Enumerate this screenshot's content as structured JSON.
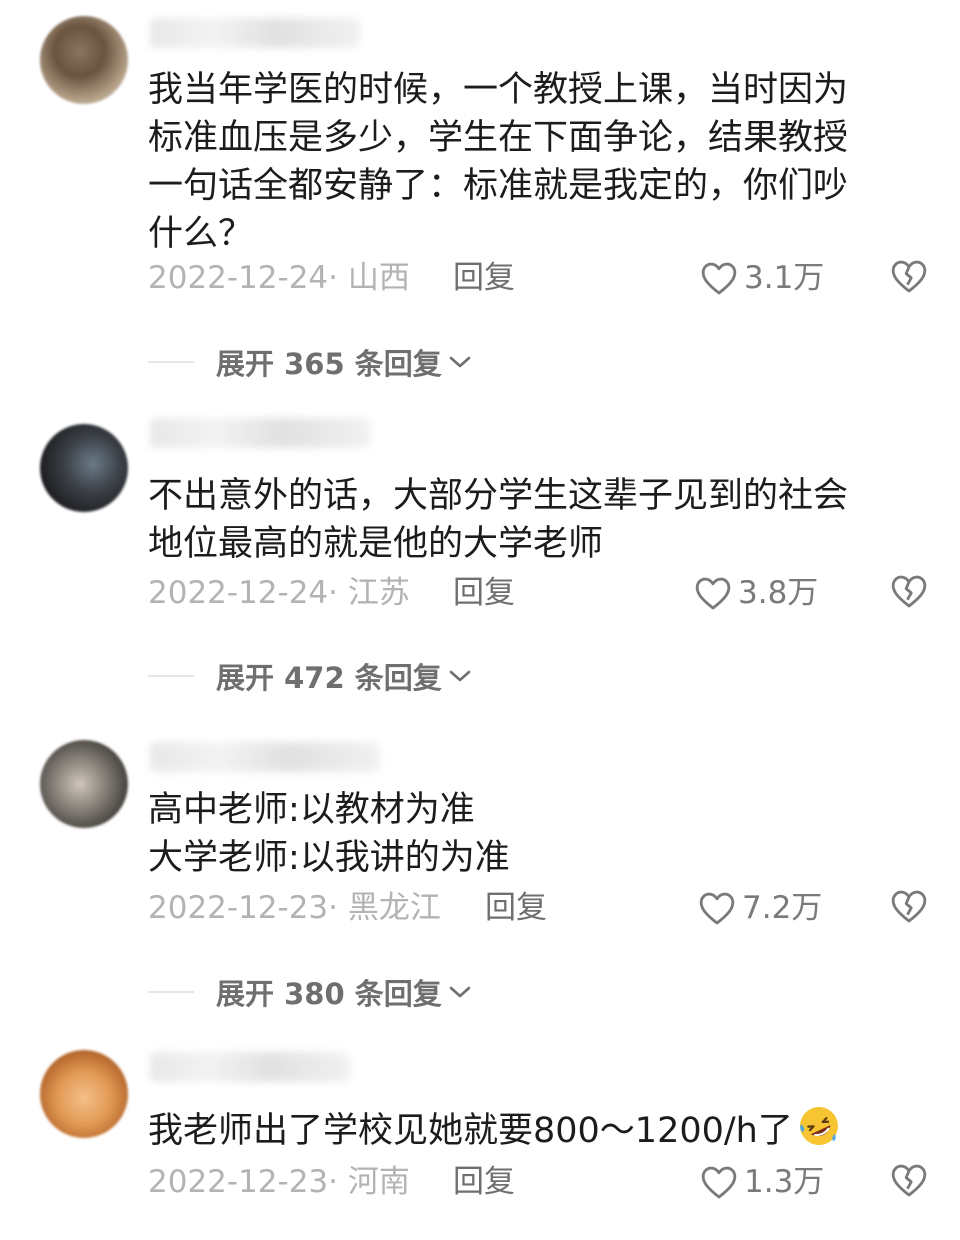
{
  "comments": [
    {
      "text": "我当年学医的时候，一个教授上课，当时因为\n标准血压是多少，学生在下面争论，结果教授\n一句话全都安静了：标准就是我定的，你们吵\n什么？",
      "date": "2022-12-24· 山西",
      "reply": "回复",
      "likes": "3.1万",
      "expand_label": "展开 365 条回复"
    },
    {
      "text": "不出意外的话，大部分学生这辈子见到的社会\n地位最高的就是他的大学老师",
      "date": "2022-12-24· 江苏",
      "reply": "回复",
      "likes": "3.8万",
      "expand_label": "展开 472 条回复"
    },
    {
      "text": "高中老师:以教材为准\n大学老师:以我讲的为准",
      "date": "2022-12-23· 黑龙江",
      "reply": "回复",
      "likes": "7.2万",
      "expand_label": "展开 380 条回复"
    },
    {
      "text": "我老师出了学校见她就要800～1200/h了",
      "date": "2022-12-23· 河南",
      "reply": "回复",
      "likes": "1.3万",
      "emoji": "rolling-on-floor-laughing-emoji"
    }
  ],
  "icons": {
    "like": "heart-outline-icon",
    "dislike": "broken-heart-icon",
    "expand": "chevron-down-icon"
  }
}
